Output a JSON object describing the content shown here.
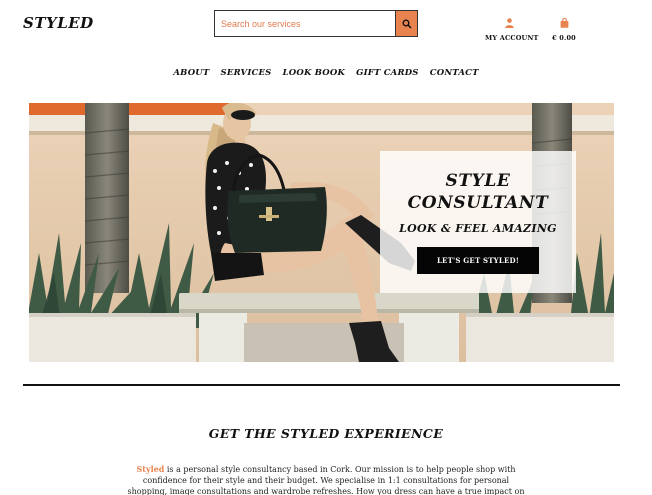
{
  "header": {
    "logo": "STYLED",
    "search": {
      "placeholder": "Search our services"
    },
    "account_label": "MY ACCOUNT",
    "cart_label": "€ 0.00"
  },
  "nav": {
    "items": [
      "ABOUT",
      "SERVICES",
      "LOOK BOOK",
      "GIFT CARDS",
      "CONTACT"
    ]
  },
  "hero": {
    "title_line1": "STYLE",
    "title_line2": "CONSULTANT",
    "subtitle": "LOOK & FEEL AMAZING",
    "cta": "LET'S GET STYLED!"
  },
  "section": {
    "heading": "GET THE STYLED EXPERIENCE",
    "brand": "Styled",
    "intro_rest": " is a personal style consultancy based in Cork. Our mission is to help people shop with confidence for their style and their budget. We specialise in 1:1 consultations for personal shopping, image consultations and wardrobe refreshes. How you dress can have a true impact on your"
  },
  "colors": {
    "accent": "#e8834f",
    "text": "#111111",
    "button_bg": "#050505"
  },
  "icons": {
    "search": "search-icon",
    "account": "user-icon",
    "cart": "shopping-bag-icon"
  }
}
